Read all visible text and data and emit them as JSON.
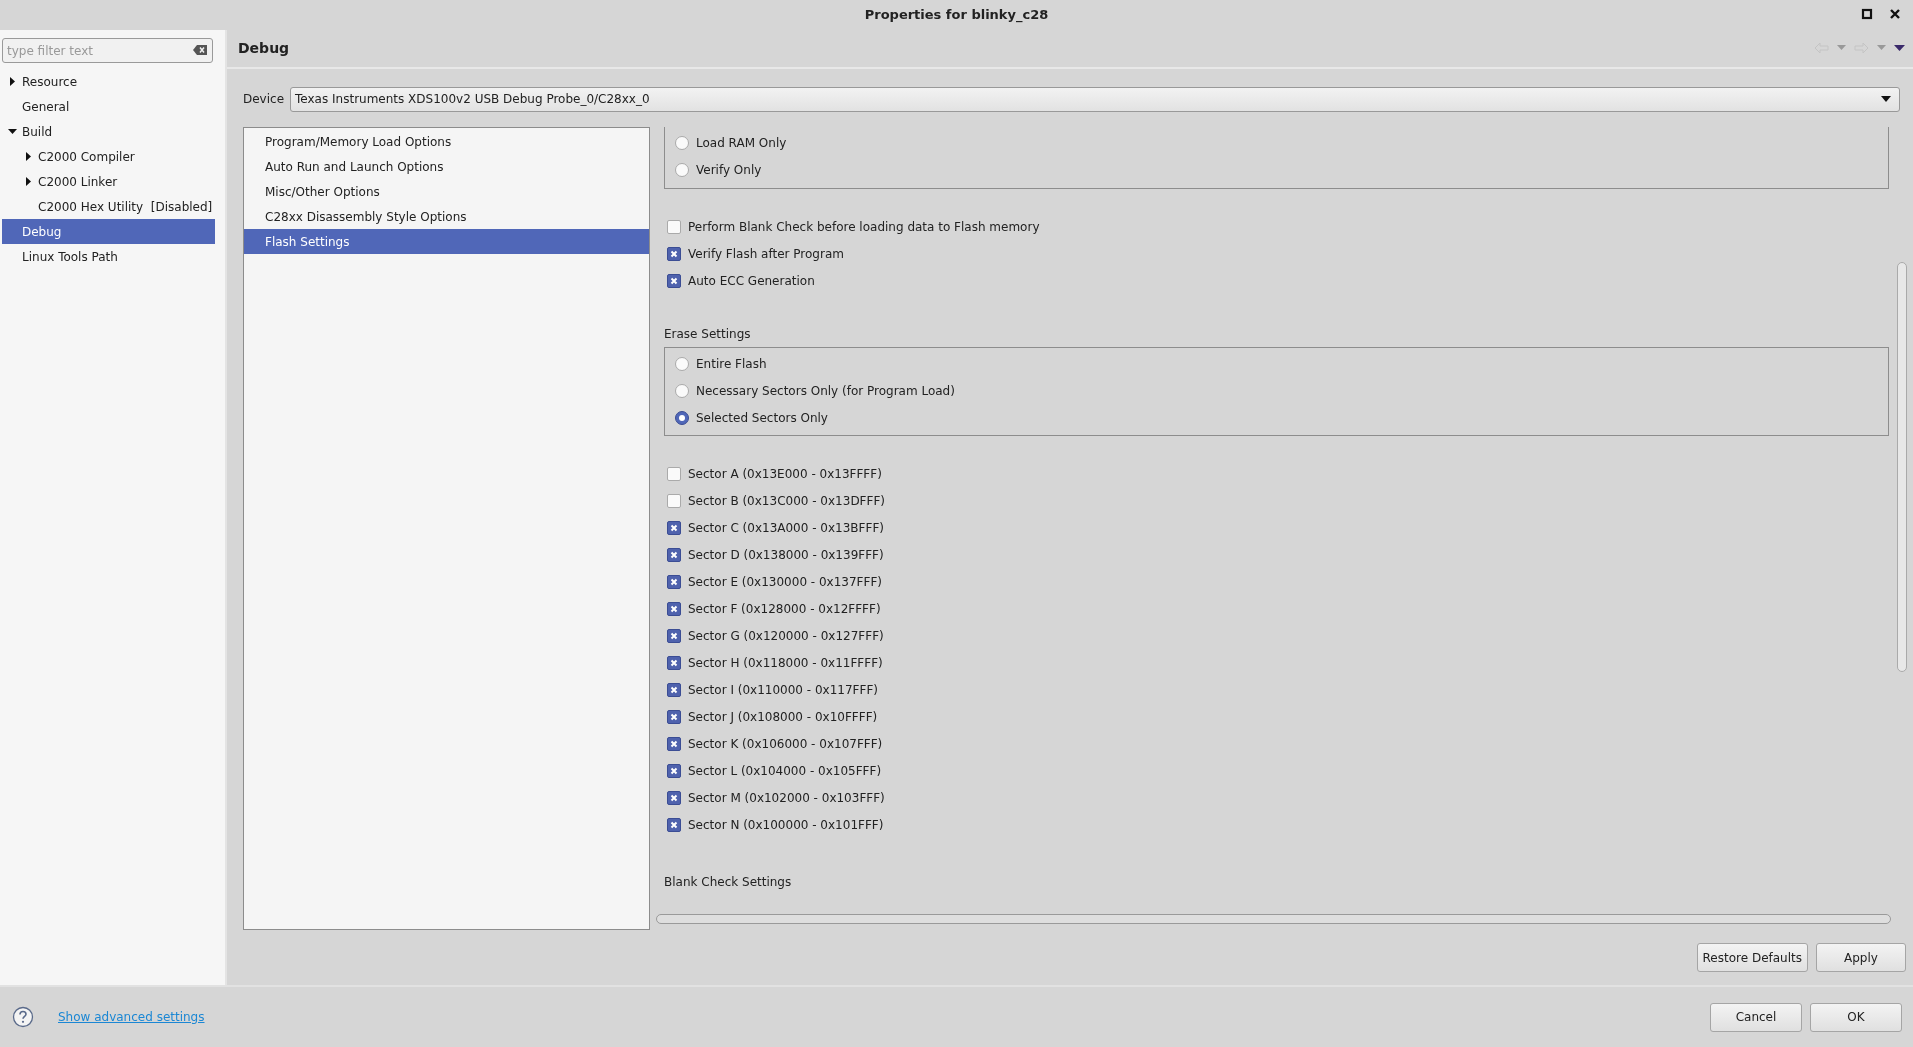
{
  "window": {
    "title": "Properties for blinky_c28"
  },
  "filter": {
    "placeholder": "type filter text"
  },
  "tree": [
    {
      "label": "Resource",
      "selected": false,
      "expanded": false
    },
    {
      "label": "General",
      "selected": false
    },
    {
      "label": "Build",
      "selected": false,
      "expanded": true,
      "children": [
        {
          "label": "C2000 Compiler",
          "selected": false,
          "expanded": false
        },
        {
          "label": "C2000 Linker",
          "selected": false,
          "expanded": false
        },
        {
          "label": "C2000 Hex Utility  [Disabled]",
          "selected": false
        }
      ]
    },
    {
      "label": "Debug",
      "selected": true
    },
    {
      "label": "Linux Tools Path",
      "selected": false
    }
  ],
  "page": {
    "title": "Debug"
  },
  "device": {
    "label": "Device",
    "value": "Texas Instruments XDS100v2 USB Debug Probe_0/C28xx_0"
  },
  "categories": [
    {
      "label": "Program/Memory Load Options",
      "selected": false
    },
    {
      "label": "Auto Run and Launch Options",
      "selected": false
    },
    {
      "label": "Misc/Other Options",
      "selected": false
    },
    {
      "label": "C28xx Disassembly Style Options",
      "selected": false
    },
    {
      "label": "Flash Settings",
      "selected": true
    }
  ],
  "load_options": [
    {
      "label": "Load RAM Only",
      "selected": false
    },
    {
      "label": "Verify Only",
      "selected": false
    }
  ],
  "flash_checks": [
    {
      "label": "Perform Blank Check before loading data to Flash memory",
      "checked": false
    },
    {
      "label": "Verify Flash after Program",
      "checked": true
    },
    {
      "label": "Auto ECC Generation",
      "checked": true
    }
  ],
  "erase_settings": {
    "title": "Erase Settings",
    "options": [
      {
        "label": "Entire Flash",
        "selected": false
      },
      {
        "label": "Necessary Sectors Only (for Program Load)",
        "selected": false
      },
      {
        "label": "Selected Sectors Only",
        "selected": true
      }
    ]
  },
  "sectors": [
    {
      "label": "Sector A (0x13E000 - 0x13FFFF)",
      "checked": false
    },
    {
      "label": "Sector B (0x13C000 - 0x13DFFF)",
      "checked": false
    },
    {
      "label": "Sector C (0x13A000 - 0x13BFFF)",
      "checked": true
    },
    {
      "label": "Sector D (0x138000 - 0x139FFF)",
      "checked": true
    },
    {
      "label": "Sector E (0x130000 - 0x137FFF)",
      "checked": true
    },
    {
      "label": "Sector F (0x128000 - 0x12FFFF)",
      "checked": true
    },
    {
      "label": "Sector G (0x120000 - 0x127FFF)",
      "checked": true
    },
    {
      "label": "Sector H (0x118000 - 0x11FFFF)",
      "checked": true
    },
    {
      "label": "Sector I (0x110000 - 0x117FFF)",
      "checked": true
    },
    {
      "label": "Sector J (0x108000 - 0x10FFFF)",
      "checked": true
    },
    {
      "label": "Sector K (0x106000 - 0x107FFF)",
      "checked": true
    },
    {
      "label": "Sector L (0x104000 - 0x105FFF)",
      "checked": true
    },
    {
      "label": "Sector M (0x102000 - 0x103FFF)",
      "checked": true
    },
    {
      "label": "Sector N (0x100000 - 0x101FFF)",
      "checked": true
    }
  ],
  "blank_check": {
    "title": "Blank Check Settings"
  },
  "page_buttons": [
    "Restore Defaults",
    "Apply"
  ],
  "footer": {
    "link": "Show advanced settings",
    "buttons": [
      "Cancel",
      "OK"
    ]
  }
}
